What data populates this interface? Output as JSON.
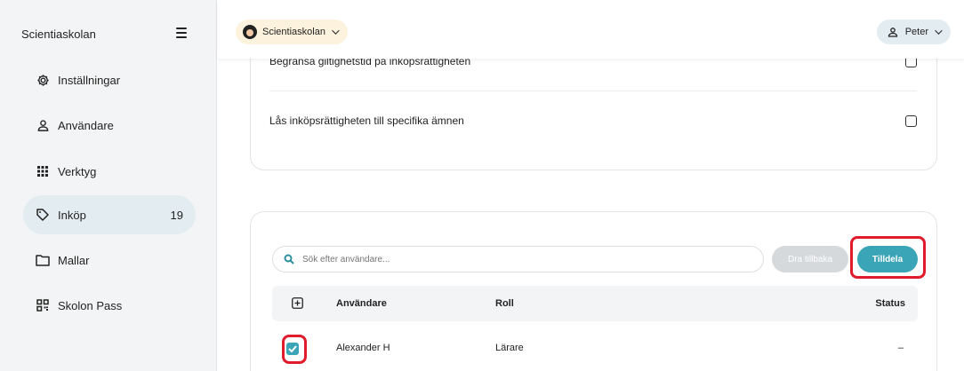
{
  "sidebar": {
    "brand": "Scientiaskolan",
    "items": [
      {
        "label": "Inställningar",
        "icon": "gear-icon"
      },
      {
        "label": "Användare",
        "icon": "user-icon"
      },
      {
        "label": "Verktyg",
        "icon": "grid-icon"
      },
      {
        "label": "Inköp",
        "icon": "tag-icon",
        "count": "19",
        "active": true
      },
      {
        "label": "Mallar",
        "icon": "folder-icon"
      },
      {
        "label": "Skolon Pass",
        "icon": "qr-code-icon"
      }
    ]
  },
  "topbar": {
    "school": "Scientiaskolan",
    "user": "Peter"
  },
  "settings": {
    "options": [
      {
        "label": "Begränsa giltighetstid på inköpsrättigheten",
        "checked": false
      },
      {
        "label": "Lås inköpsrättigheten till specifika ämnen",
        "checked": false
      }
    ]
  },
  "assign": {
    "search_placeholder": "Sök efter användare...",
    "return_label": "Dra tillbaka",
    "assign_label": "Tilldela",
    "columns": {
      "user": "Användare",
      "role": "Roll",
      "status": "Status"
    },
    "rows": [
      {
        "user": "Alexander H",
        "role": "Lärare",
        "status": "–",
        "checked": true
      }
    ]
  },
  "colors": {
    "accent": "#3aa5b6",
    "highlight": "#e01b2c",
    "active_nav": "#e3edf1",
    "school_chip": "#fdf2dd"
  }
}
